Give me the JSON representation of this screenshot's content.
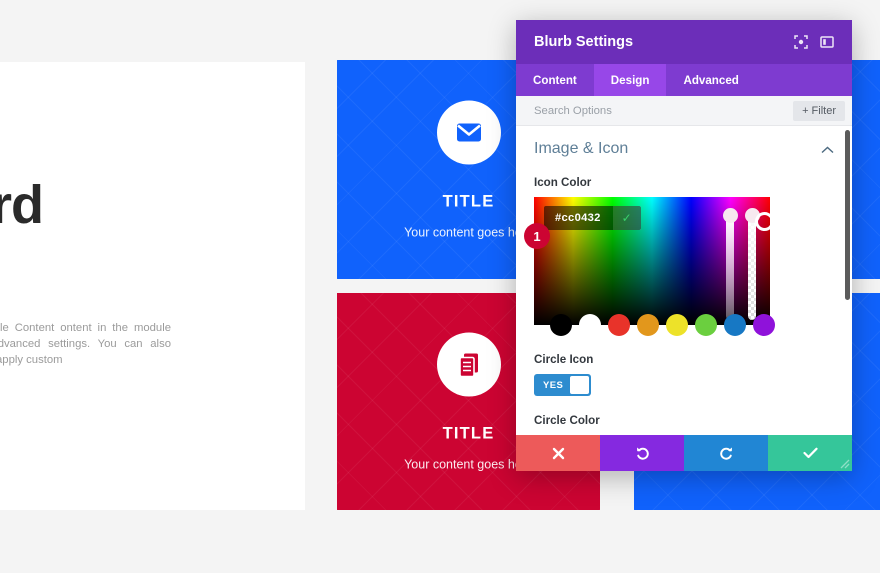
{
  "page": {
    "heading": "e to\nhboard",
    "body": "ext inline or in the module Content ontent in the module Design settings odule Advanced settings. You can also Design settings and even apply custom"
  },
  "cards": [
    {
      "title": "TITLE",
      "subtitle": "Your content goes here",
      "icon": "envelope-icon",
      "color": "#1062fc"
    },
    {
      "title": "TITLE",
      "subtitle": "Your content goes here",
      "icon": "document-icon",
      "color": "#cc0432"
    }
  ],
  "modal": {
    "title": "Blurb Settings",
    "header_icons": [
      {
        "name": "focus-target-icon"
      },
      {
        "name": "layout-panel-icon"
      }
    ],
    "tabs": [
      {
        "label": "Content",
        "active": false
      },
      {
        "label": "Design",
        "active": true
      },
      {
        "label": "Advanced",
        "active": false
      }
    ],
    "search": {
      "placeholder": "Search Options",
      "value": "",
      "filter_label": "+ Filter"
    },
    "section": {
      "title": "Image & Icon",
      "collapse_icon": "chevron-up-icon"
    },
    "icon_color": {
      "label": "Icon Color",
      "hex": "#cc0432",
      "confirm_icon": "check-icon",
      "step_badge": "1",
      "swatches": [
        "#000000",
        "#ffffff",
        "#e8332a",
        "#e2971c",
        "#ede229",
        "#6bcf3f",
        "#1778c4",
        "#8f12da"
      ]
    },
    "circle_icon": {
      "label": "Circle Icon",
      "toggle_value": "YES"
    },
    "circle_color": {
      "label": "Circle Color"
    },
    "actions": [
      {
        "name": "cancel-button",
        "icon": "close-icon"
      },
      {
        "name": "undo-button",
        "icon": "undo-icon"
      },
      {
        "name": "redo-button",
        "icon": "redo-icon"
      },
      {
        "name": "save-button",
        "icon": "check-icon"
      }
    ]
  }
}
